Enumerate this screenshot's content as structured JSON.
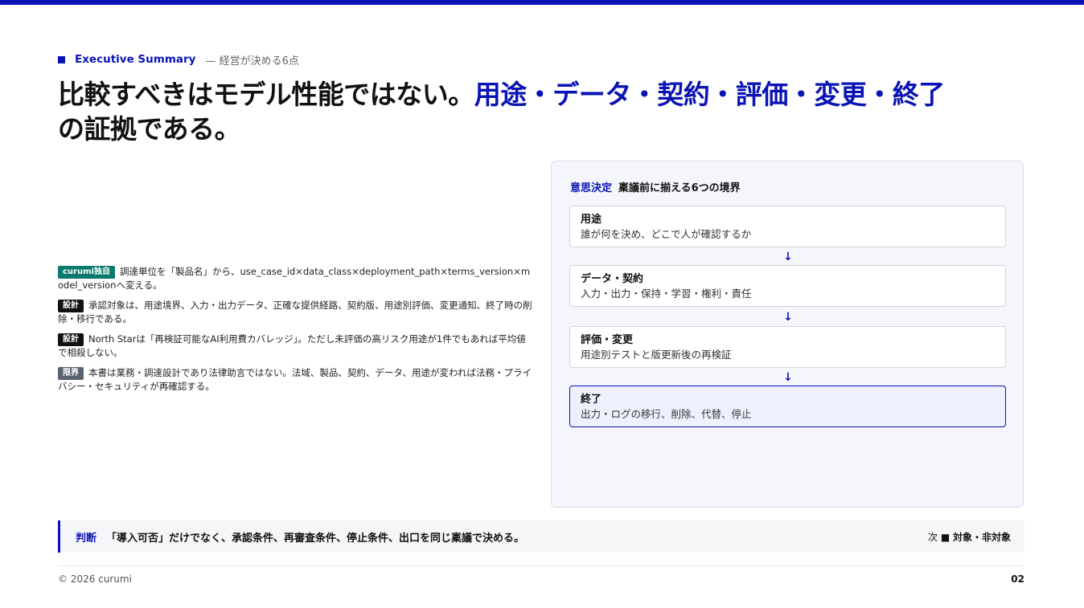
{
  "header": {
    "eyebrow_label": "Executive Summary",
    "eyebrow_sub": "— 経営が決める6点",
    "headline_plain": "比較すべきはモデル性能ではない。",
    "headline_accent": "用途・データ・契約・評価・変更・終了",
    "headline_tail": "の証拠である。"
  },
  "notes": [
    {
      "tag": "curumi独自",
      "text": "調達単位を「製品名」から、use_case_id×data_class×deployment_path×terms_version×model_versionへ変える。"
    },
    {
      "tag": "設計",
      "text": "承認対象は、用途境界、入力・出力データ、正確な提供経路、契約版、用途別評価、変更通知、終了時の削除・移行である。"
    },
    {
      "tag": "設計",
      "text": "North Starは「再検証可能なAI利用費カバレッジ」。ただし未評価の高リスク用途が1件でもあれば平均値で相殺しない。"
    },
    {
      "tag": "限界",
      "text": "本書は業務・調達設計であり法律助言ではない。法域、製品、契約、データ、用途が変われば法務・プライバシー・セキュリティが再確認する。"
    }
  ],
  "panel": {
    "kicker": "意思決定",
    "title": "稟議前に揃える6つの境界",
    "steps": [
      {
        "title": "用途",
        "desc": "誰が何を決め、どこで人が確認するか"
      },
      {
        "title": "データ・契約",
        "desc": "入力・出力・保持・学習・権利・責任"
      },
      {
        "title": "評価・変更",
        "desc": "用途別テストと版更新後の再検証"
      },
      {
        "title": "終了",
        "desc": "出力・ログの移行、削除、代替、停止"
      }
    ],
    "arrow": "↓"
  },
  "judgement": {
    "kicker": "判断",
    "text": "「導入可否」だけでなく、承認条件、再審査条件、停止条件、出口を同じ稟議で決める。",
    "next_prefix": "次 ■",
    "next_label": "対象・非対象"
  },
  "footer": {
    "copyright": "© 2026 curumi",
    "page": "02"
  },
  "colors": {
    "accent": "#0a14b4",
    "tag_teal": "#0b7a6e",
    "tag_black": "#111111",
    "tag_gray": "#5a6270"
  }
}
